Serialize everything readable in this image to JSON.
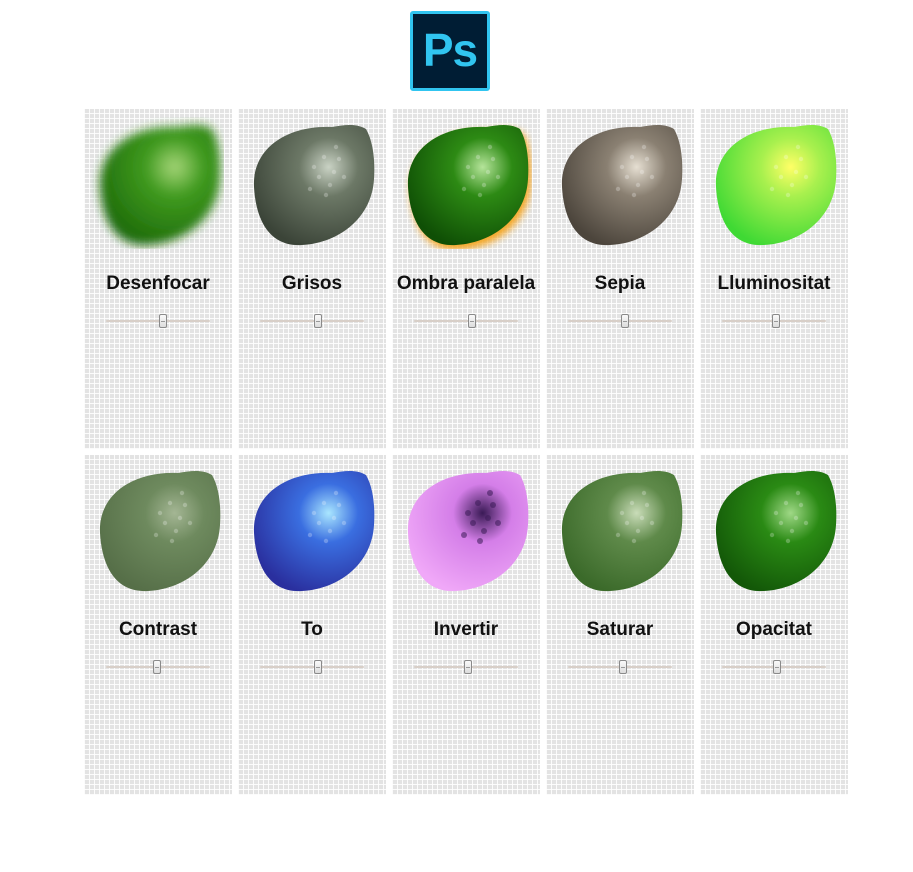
{
  "header": {
    "logo_text": "Ps",
    "logo_colors": {
      "background": "#001d34",
      "accent": "#31c5f0"
    }
  },
  "filters": [
    {
      "label": "Desenfocar",
      "slider_value": 0.55,
      "fill": "#3f9a1e",
      "shade": "#1d6a0a",
      "highlight": "#a8d77a",
      "effect": "blur"
    },
    {
      "label": "Grisos",
      "slider_value": 0.56,
      "fill": "#6c7866",
      "shade": "#3b4438",
      "highlight": "#c9d2c4",
      "effect": "none"
    },
    {
      "label": "Ombra paralela",
      "slider_value": 0.56,
      "fill": "#2d8a14",
      "shade": "#0f4f05",
      "highlight": "#b5e49a",
      "effect": "shadow"
    },
    {
      "label": "Sepia",
      "slider_value": 0.55,
      "fill": "#8a8072",
      "shade": "#4c453c",
      "highlight": "#e6dfd2",
      "effect": "none"
    },
    {
      "label": "Lluminositat",
      "slider_value": 0.52,
      "fill": "#a8f04e",
      "shade": "#3fd934",
      "highlight": "#ffff66",
      "effect": "bright"
    },
    {
      "label": "Contrast",
      "slider_value": 0.49,
      "fill": "#6e8a5e",
      "shade": "#566f48",
      "highlight": "#a4b694",
      "effect": "none"
    },
    {
      "label": "To",
      "slider_value": 0.56,
      "fill": "#3a6ee0",
      "shade": "#2a2f9e",
      "highlight": "#a9e6ff",
      "effect": "none"
    },
    {
      "label": "Invertir",
      "slider_value": 0.52,
      "fill": "#d47ee8",
      "shade": "#f0a8f8",
      "highlight": "#3a1a56",
      "effect": "invert"
    },
    {
      "label": "Saturar",
      "slider_value": 0.53,
      "fill": "#5f8a4a",
      "shade": "#3b6a2a",
      "highlight": "#c9dcb8",
      "effect": "none"
    },
    {
      "label": "Opacitat",
      "slider_value": 0.53,
      "fill": "#2a8a14",
      "shade": "#135808",
      "highlight": "#9fd886",
      "effect": "none"
    }
  ]
}
